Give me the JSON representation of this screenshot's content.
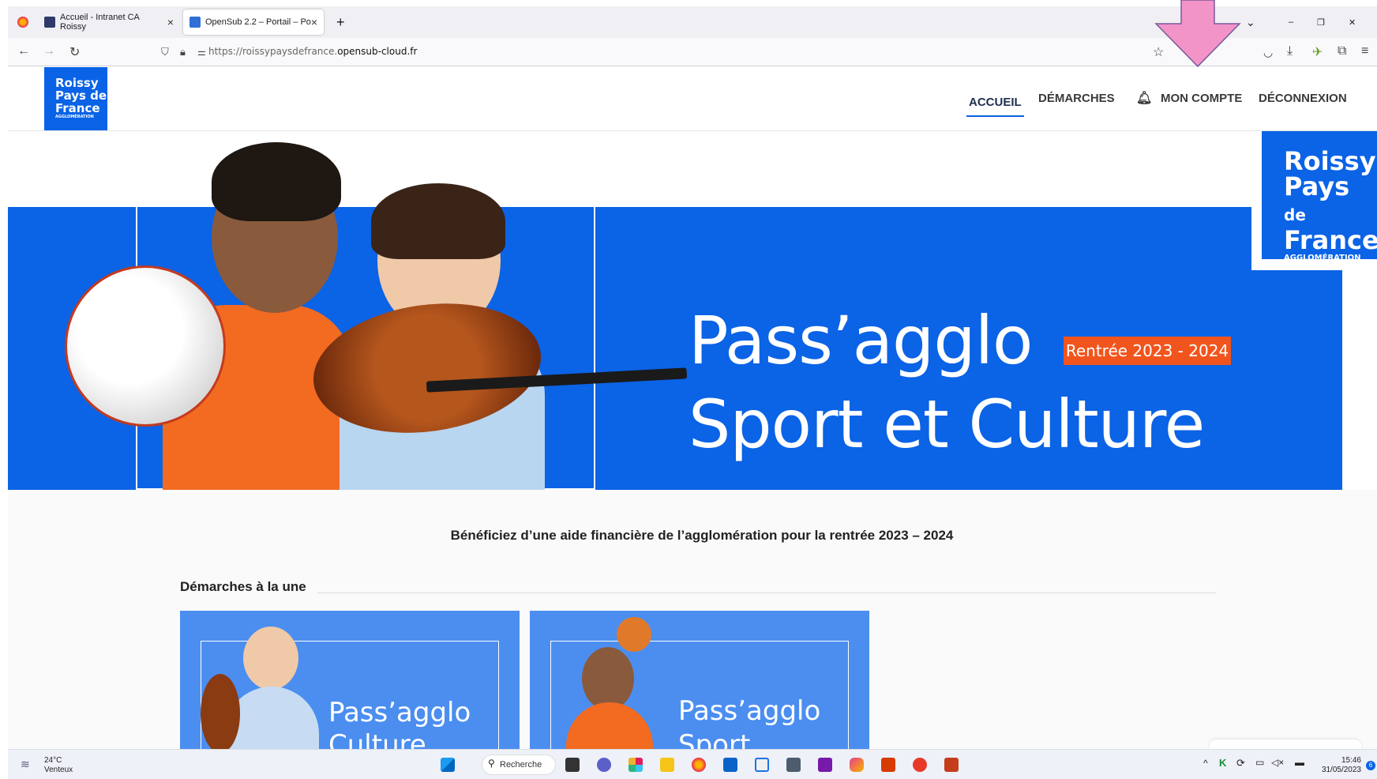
{
  "browser": {
    "tabs": [
      {
        "label": "Accueil - Intranet CA Roissy"
      },
      {
        "label": "OpenSub 2.2 – Portail – Portail"
      }
    ],
    "url_prefix": "https://roissypaysdefrance.",
    "url_domain": "opensub-cloud.fr"
  },
  "site": {
    "logo_small": {
      "line1": "Roissy",
      "line2": "Pays de",
      "line3": "France",
      "sub": "AGGLOMÉRATION"
    },
    "menu": [
      "ACCUEIL",
      "DÉMARCHES",
      "MON COMPTE",
      "DÉCONNEXION"
    ]
  },
  "hero": {
    "title1": "Pass’agglo",
    "badge": "Rentrée 2023 - 2024",
    "title2": "Sport et Culture",
    "logo_big": {
      "line1": "Roissy",
      "line2a": "Pays ",
      "line2b": "de",
      "line3": "France",
      "sub": "AGGLOMÉRATION"
    }
  },
  "content": {
    "intro": "Bénéficiez d’une aide financière de l’agglomération pour la rentrée 2023 – 2024",
    "section_title": "Démarches à la une",
    "cards": [
      {
        "line1": "Pass’agglo",
        "line2": "Culture"
      },
      {
        "line1": "Pass’agglo",
        "line2": "Sport"
      }
    ]
  },
  "taskbar": {
    "temperature": "24°C",
    "weather": "Venteux",
    "search": "Recherche",
    "time": "15:46",
    "date": "31/05/2023"
  },
  "colors": {
    "brand_blue": "#0b63e6",
    "badge_orange": "#f1551d",
    "annotation_pink": "#f394c9"
  }
}
